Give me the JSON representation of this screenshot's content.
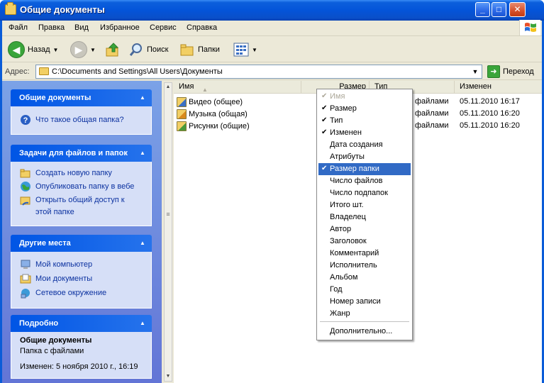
{
  "window": {
    "title": "Общие документы",
    "controls": {
      "minimize": "_",
      "maximize": "□",
      "close": "✕"
    }
  },
  "menu": [
    "Файл",
    "Правка",
    "Вид",
    "Избранное",
    "Сервис",
    "Справка"
  ],
  "toolbar": {
    "back": "Назад",
    "search": "Поиск",
    "folders": "Папки"
  },
  "address": {
    "label": "Адрес:",
    "path": "C:\\Documents and Settings\\All Users\\Документы",
    "go": "Переход"
  },
  "sidebar": {
    "panel_shared": {
      "title": "Общие документы",
      "items": [
        "Что такое общая папка?"
      ]
    },
    "panel_tasks": {
      "title": "Задачи для файлов и папок",
      "items": [
        "Создать новую папку",
        "Опубликовать папку в вебе",
        "Открыть общий доступ к",
        "этой папке"
      ]
    },
    "panel_places": {
      "title": "Другие места",
      "items": [
        "Мой компьютер",
        "Мои документы",
        "Сетевое окружение"
      ]
    },
    "panel_details": {
      "title": "Подробно",
      "name": "Общие документы",
      "type": "Папка с файлами",
      "modified": "Изменен: 5 ноября 2010 г., 16:19"
    }
  },
  "columns": {
    "name": "Имя",
    "size": "Размер",
    "type": "Тип",
    "modified": "Изменен"
  },
  "files": [
    {
      "name": "Видео (общее)",
      "type_tail": "файлами",
      "modified": "05.11.2010 16:17",
      "icon_color": "#3a6fc4"
    },
    {
      "name": "Музыка (общая)",
      "type_tail": "файлами",
      "modified": "05.11.2010 16:20",
      "icon_color": "#d98a1c"
    },
    {
      "name": "Рисунки (общие)",
      "type_tail": "файлами",
      "modified": "05.11.2010 16:20",
      "icon_color": "#4a9a3a"
    }
  ],
  "context_menu": {
    "items": [
      {
        "label": "Имя",
        "checked": true,
        "disabled": true,
        "selected": false
      },
      {
        "label": "Размер",
        "checked": true,
        "disabled": false,
        "selected": false
      },
      {
        "label": "Тип",
        "checked": true,
        "disabled": false,
        "selected": false
      },
      {
        "label": "Изменен",
        "checked": true,
        "disabled": false,
        "selected": false
      },
      {
        "label": "Дата создания",
        "checked": false,
        "disabled": false,
        "selected": false
      },
      {
        "label": "Атрибуты",
        "checked": false,
        "disabled": false,
        "selected": false
      },
      {
        "label": "Размер папки",
        "checked": true,
        "disabled": false,
        "selected": true
      },
      {
        "label": "Число файлов",
        "checked": false,
        "disabled": false,
        "selected": false
      },
      {
        "label": "Число подпапок",
        "checked": false,
        "disabled": false,
        "selected": false
      },
      {
        "label": "Итого шт.",
        "checked": false,
        "disabled": false,
        "selected": false
      },
      {
        "label": "Владелец",
        "checked": false,
        "disabled": false,
        "selected": false
      },
      {
        "label": "Автор",
        "checked": false,
        "disabled": false,
        "selected": false
      },
      {
        "label": "Заголовок",
        "checked": false,
        "disabled": false,
        "selected": false
      },
      {
        "label": "Комментарий",
        "checked": false,
        "disabled": false,
        "selected": false
      },
      {
        "label": "Исполнитель",
        "checked": false,
        "disabled": false,
        "selected": false
      },
      {
        "label": "Альбом",
        "checked": false,
        "disabled": false,
        "selected": false
      },
      {
        "label": "Год",
        "checked": false,
        "disabled": false,
        "selected": false
      },
      {
        "label": "Номер записи",
        "checked": false,
        "disabled": false,
        "selected": false
      },
      {
        "label": "Жанр",
        "checked": false,
        "disabled": false,
        "selected": false
      }
    ],
    "more": "Дополнительно...",
    "check_glyph": "✔"
  },
  "colors": {
    "titlebar": "#0454d9",
    "selection": "#316ac5",
    "link": "#0c32a0"
  }
}
